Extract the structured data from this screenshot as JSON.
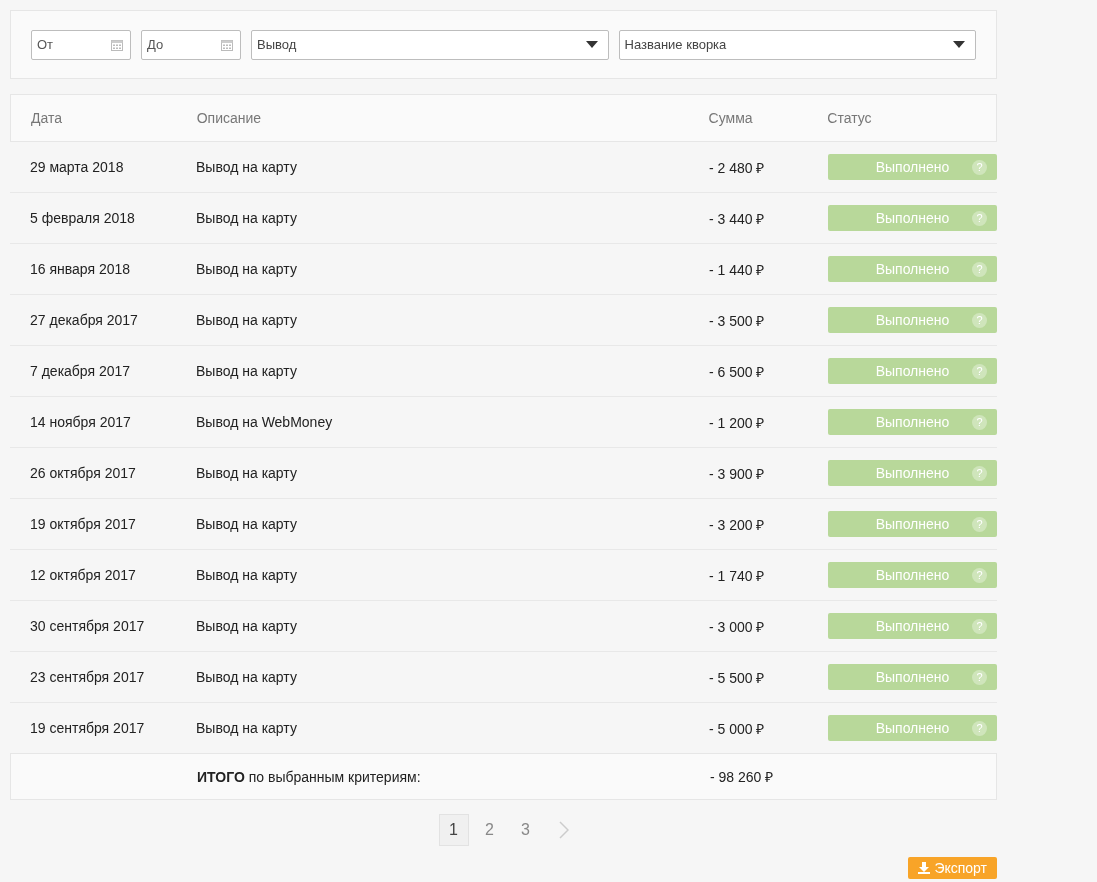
{
  "filters": {
    "date_from": {
      "placeholder": "От"
    },
    "date_to": {
      "placeholder": "До"
    },
    "type_select": {
      "value": "Вывод"
    },
    "kwork_select": {
      "value": "Название кворка"
    }
  },
  "table": {
    "columns": [
      "Дата",
      "Описание",
      "Сумма",
      "Статус"
    ],
    "rows": [
      {
        "date": "29 марта 2018",
        "description": "Вывод на карту",
        "amount": "- 2 480 ₽",
        "status": "Выполнено",
        "help": "?"
      },
      {
        "date": "5 февраля 2018",
        "description": "Вывод на карту",
        "amount": "- 3 440 ₽",
        "status": "Выполнено",
        "help": "?"
      },
      {
        "date": "16 января 2018",
        "description": "Вывод на карту",
        "amount": "- 1 440 ₽",
        "status": "Выполнено",
        "help": "?"
      },
      {
        "date": "27 декабря 2017",
        "description": "Вывод на карту",
        "amount": "- 3 500 ₽",
        "status": "Выполнено",
        "help": "?"
      },
      {
        "date": "7 декабря 2017",
        "description": "Вывод на карту",
        "amount": "- 6 500 ₽",
        "status": "Выполнено",
        "help": "?"
      },
      {
        "date": "14 ноября 2017",
        "description": "Вывод на WebMoney",
        "amount": "- 1 200 ₽",
        "status": "Выполнено",
        "help": "?"
      },
      {
        "date": "26 октября 2017",
        "description": "Вывод на карту",
        "amount": "- 3 900 ₽",
        "status": "Выполнено",
        "help": "?"
      },
      {
        "date": "19 октября 2017",
        "description": "Вывод на карту",
        "amount": "- 3 200 ₽",
        "status": "Выполнено",
        "help": "?"
      },
      {
        "date": "12 октября 2017",
        "description": "Вывод на карту",
        "amount": "- 1 740 ₽",
        "status": "Выполнено",
        "help": "?"
      },
      {
        "date": "30 сентября 2017",
        "description": "Вывод на карту",
        "amount": "- 3 000 ₽",
        "status": "Выполнено",
        "help": "?"
      },
      {
        "date": "23 сентября 2017",
        "description": "Вывод на карту",
        "amount": "- 5 500 ₽",
        "status": "Выполнено",
        "help": "?"
      },
      {
        "date": "19 сентября 2017",
        "description": "Вывод на карту",
        "amount": "- 5 000 ₽",
        "status": "Выполнено",
        "help": "?"
      }
    ],
    "total": {
      "label": "**ИТОГО** по выбранным критериям:",
      "amount": "- 98 260 ₽"
    }
  },
  "pagination": [
    {
      "label": "1",
      "selected": true
    },
    {
      "label": "2",
      "selected": false
    },
    {
      "label": "3",
      "selected": false
    }
  ],
  "export_button": {
    "label": "Экспорт"
  }
}
